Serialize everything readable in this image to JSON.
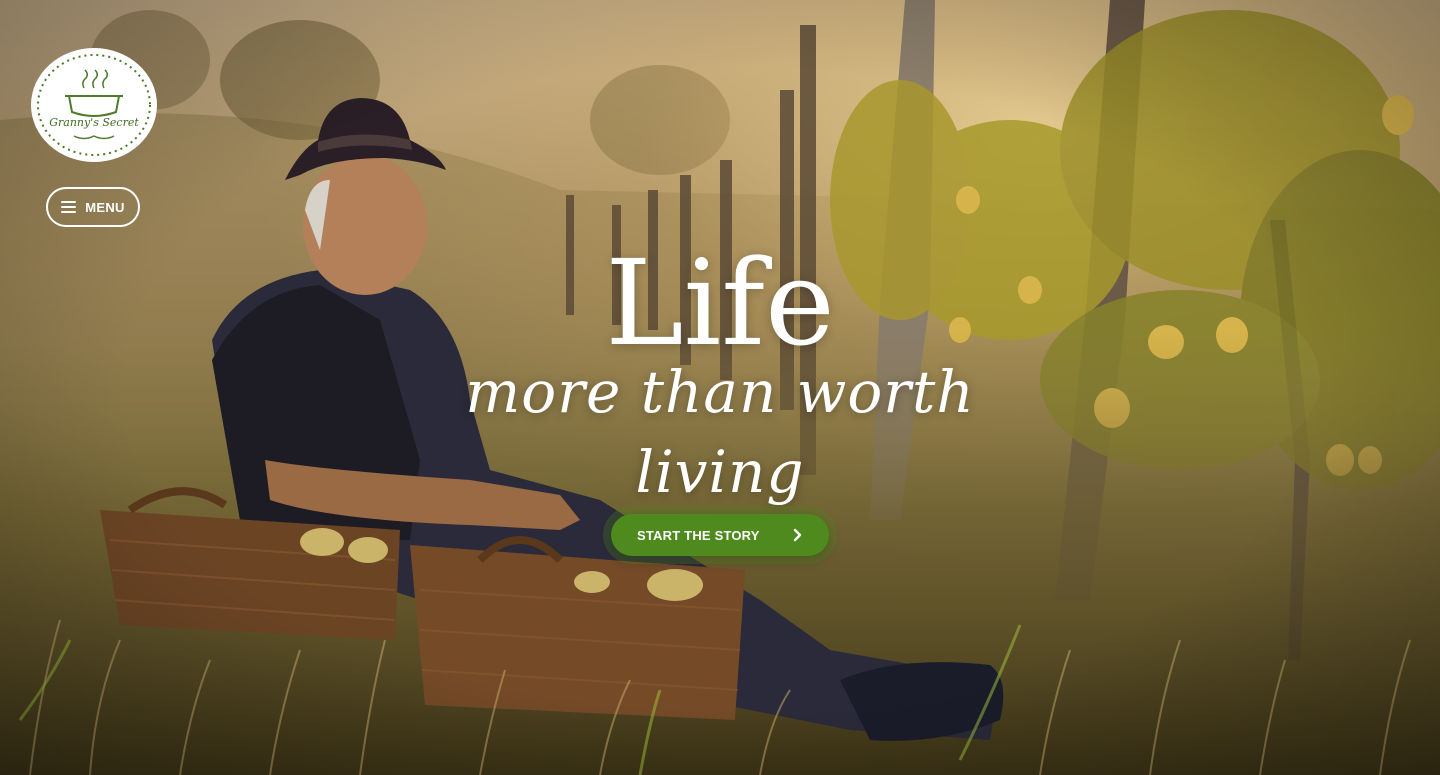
{
  "brand": {
    "name": "Granny's Secret",
    "logo_icon": "cooking-pot-icon",
    "accent_color": "#4e8a1e"
  },
  "nav": {
    "menu_label": "MENU",
    "menu_icon": "hamburger-icon"
  },
  "hero": {
    "title": "Life",
    "subtitle": "more than worth living",
    "cta_label": "START THE STORY",
    "cta_icon": "chevron-right-icon",
    "cta_color": "#4e8a1e"
  }
}
